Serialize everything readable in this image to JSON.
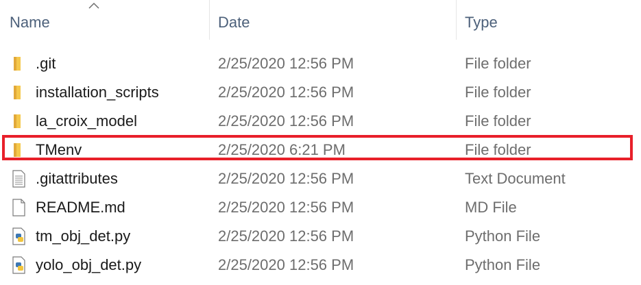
{
  "columns": {
    "name": "Name",
    "date": "Date",
    "type": "Type"
  },
  "colors": {
    "highlight": "#e8202a",
    "folder": "#f5c84c",
    "header_text": "#4c607a"
  },
  "rows": [
    {
      "name": ".git",
      "date": "2/25/2020 12:56 PM",
      "type": "File folder",
      "icon": "folder-icon"
    },
    {
      "name": "installation_scripts",
      "date": "2/25/2020 12:56 PM",
      "type": "File folder",
      "icon": "folder-icon"
    },
    {
      "name": "la_croix_model",
      "date": "2/25/2020 12:56 PM",
      "type": "File folder",
      "icon": "folder-icon"
    },
    {
      "name": "TMenv",
      "date": "2/25/2020 6:21 PM",
      "type": "File folder",
      "icon": "folder-icon"
    },
    {
      "name": ".gitattributes",
      "date": "2/25/2020 12:56 PM",
      "type": "Text Document",
      "icon": "text-document-icon"
    },
    {
      "name": "README.md",
      "date": "2/25/2020 12:56 PM",
      "type": "MD File",
      "icon": "file-icon"
    },
    {
      "name": "tm_obj_det.py",
      "date": "2/25/2020 12:56 PM",
      "type": "Python File",
      "icon": "python-file-icon"
    },
    {
      "name": "yolo_obj_det.py",
      "date": "2/25/2020 12:56 PM",
      "type": "Python File",
      "icon": "python-file-icon"
    }
  ]
}
